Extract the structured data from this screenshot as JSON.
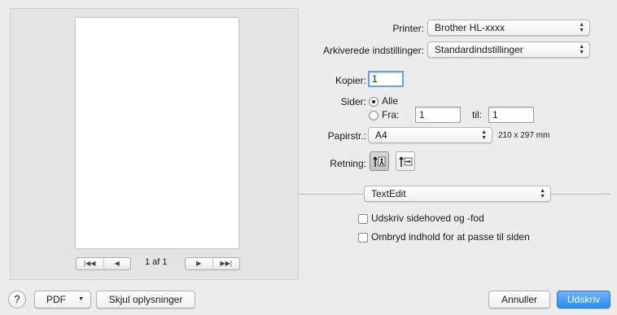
{
  "preview": {
    "page_count": "1 af 1",
    "nav_first": "|◀◀",
    "nav_prev": "◀",
    "nav_next": "▶",
    "nav_last": "▶▶|"
  },
  "printer": {
    "label": "Printer:",
    "value": "Brother HL-xxxx"
  },
  "presets": {
    "label": "Arkiverede indstillinger:",
    "value": "Standardindstillinger"
  },
  "copies": {
    "label": "Kopier:",
    "value": "1"
  },
  "pages": {
    "label": "Sider:",
    "all_label": "Alle",
    "from_label": "Fra:",
    "from_value": "1",
    "to_label": "til:",
    "to_value": "1",
    "selected": "Alle"
  },
  "paper_size": {
    "label": "Papirstr.:",
    "value": "A4",
    "dimensions": "210 x 297 mm"
  },
  "orientation": {
    "label": "Retning:",
    "selected": "portrait"
  },
  "section": {
    "value": "TextEdit"
  },
  "options": {
    "print_header_footer": "Udskriv sidehoved og -fod",
    "wrap_contents": "Ombryd indhold for at passe til siden"
  },
  "footer": {
    "help": "?",
    "pdf": "PDF",
    "pdf_arrow": "▼",
    "hide_details": "Skjul oplysninger",
    "cancel": "Annuller",
    "print": "Udskriv"
  },
  "colors": {
    "accent": "#2a8cf0",
    "background": "#ececec"
  },
  "icons": {
    "popup_arrows": "⌃⌄",
    "portrait": "portrait-orientation-icon",
    "landscape": "landscape-orientation-icon"
  }
}
